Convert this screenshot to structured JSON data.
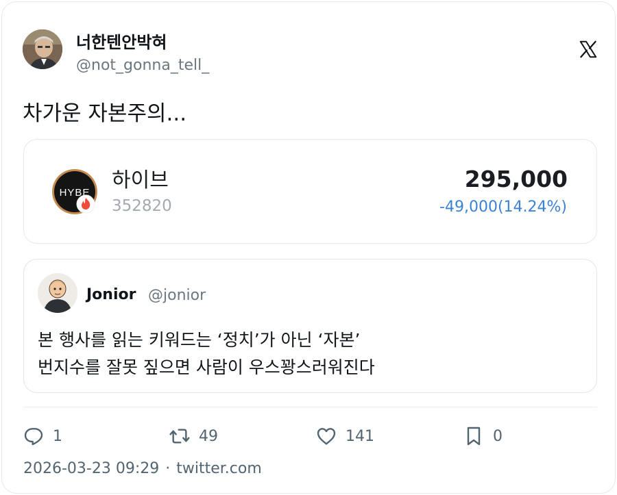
{
  "author": {
    "display_name": "너한텐안박혀",
    "handle": "@not_gonna_tell_"
  },
  "tweet": {
    "text": "차가운 자본주의..."
  },
  "stock": {
    "name": "하이브",
    "code": "352820",
    "price": "295,000",
    "change": "-49,000(14.24%)",
    "logo_text": "HYBE"
  },
  "quoted": {
    "name": "Jonior",
    "handle": "@jonior",
    "lines": [
      "본 행사를 읽는 키워드는 ‘정치’가 아닌 ‘자본’",
      "번지수를 잘못 짚으면 사람이 우스꽝스러워진다"
    ]
  },
  "actions": {
    "replies": "1",
    "retweets": "49",
    "likes": "141",
    "bookmarks": "0"
  },
  "meta": {
    "timestamp": "2026-03-23 09:29",
    "separator": "·",
    "source": "twitter.com"
  },
  "colors": {
    "change_down": "#3b82d6",
    "text_primary": "#0f1419",
    "text_secondary": "#536471"
  },
  "icons": [
    "x-logo-icon",
    "reply-icon",
    "retweet-icon",
    "like-icon",
    "bookmark-icon",
    "fire-icon"
  ]
}
